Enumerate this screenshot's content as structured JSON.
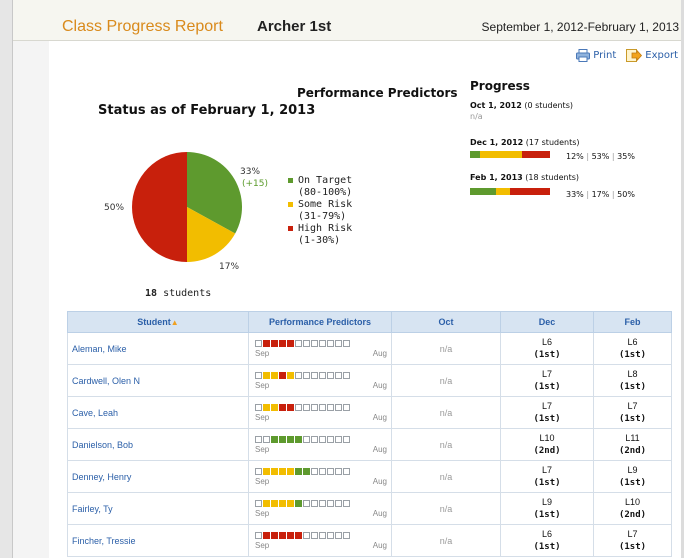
{
  "header": {
    "title": "Class Progress Report",
    "class_name": "Archer 1st",
    "date_range": "September 1, 2012-February 1, 2013"
  },
  "toolbar": {
    "print_label": "Print",
    "export_label": "Export",
    "print_icon": "printer-icon",
    "export_icon": "export-icon"
  },
  "status": {
    "title": "Status as of February 1, 2013",
    "students_count": "18",
    "students_label": "students"
  },
  "performance": {
    "title": "Performance Predictors"
  },
  "pie": {
    "slices": [
      {
        "name": "On Target",
        "value": 33,
        "color": "#5e9a2e"
      },
      {
        "name": "Some Risk",
        "value": 17,
        "color": "#f2bd00"
      },
      {
        "name": "High Risk",
        "value": 50,
        "color": "#c8200c"
      }
    ],
    "label_green": "33%",
    "label_green_delta": "(+15)",
    "label_yellow": "17%",
    "label_red": "50%"
  },
  "legend": [
    {
      "line1": "On Target",
      "line2": "(80-100%)",
      "color": "#5e9a2e"
    },
    {
      "line1": "Some Risk",
      "line2": "(31-79%)",
      "color": "#f2bd00"
    },
    {
      "line1": "High Risk",
      "line2": "(1-30%)",
      "color": "#c8200c"
    }
  ],
  "progress": {
    "title": "Progress",
    "rows": [
      {
        "date": "Oct 1, 2012",
        "count": "(0 students)",
        "na": "n/a"
      },
      {
        "date": "Dec 1, 2012",
        "count": "(17 students)",
        "green": 12,
        "yellow": 53,
        "red": 35,
        "p_green": "12%",
        "p_yellow": "53%",
        "p_red": "35%"
      },
      {
        "date": "Feb 1, 2013",
        "count": "(18 students)",
        "green": 33,
        "yellow": 17,
        "red": 50,
        "p_green": "33%",
        "p_yellow": "17%",
        "p_red": "50%"
      }
    ],
    "sep": "|"
  },
  "table": {
    "headers": {
      "student": "Student",
      "predictors": "Performance Predictors",
      "oct": "Oct",
      "dec": "Dec",
      "feb": "Feb"
    },
    "sort_indicator": "▲",
    "sep_label": "Sep",
    "aug_label": "Aug",
    "rows": [
      {
        "name": "Aleman, Mike",
        "squares": "errrreeeeee",
        "oct": "n/a",
        "dec_level": "L6",
        "dec_rank": "(1st)",
        "feb_level": "L6",
        "feb_rank": "(1st)"
      },
      {
        "name": "Cardwell, Olen N",
        "squares": "eyyryeeeeee",
        "oct": "n/a",
        "dec_level": "L7",
        "dec_rank": "(1st)",
        "feb_level": "L8",
        "feb_rank": "(1st)"
      },
      {
        "name": "Cave, Leah",
        "squares": "eyyrreeeeee",
        "oct": "n/a",
        "dec_level": "L7",
        "dec_rank": "(1st)",
        "feb_level": "L7",
        "feb_rank": "(1st)"
      },
      {
        "name": "Danielson, Bob",
        "squares": "eeggggeeeee",
        "oct": "n/a",
        "dec_level": "L10",
        "dec_rank": "(2nd)",
        "feb_level": "L11",
        "feb_rank": "(2nd)"
      },
      {
        "name": "Denney, Henry",
        "squares": "eyyyyggeeeee",
        "oct": "n/a",
        "dec_level": "L7",
        "dec_rank": "(1st)",
        "feb_level": "L9",
        "feb_rank": "(1st)"
      },
      {
        "name": "Fairley, Ty",
        "squares": "eyyyygeeeee",
        "oct": "n/a",
        "dec_level": "L9",
        "dec_rank": "(1st)",
        "feb_level": "L10",
        "feb_rank": "(2nd)"
      },
      {
        "name": "Fincher, Tressie",
        "squares": "errrrreeeee",
        "oct": "n/a",
        "dec_level": "L6",
        "dec_rank": "(1st)",
        "feb_level": "L7",
        "feb_rank": "(1st)"
      }
    ]
  }
}
